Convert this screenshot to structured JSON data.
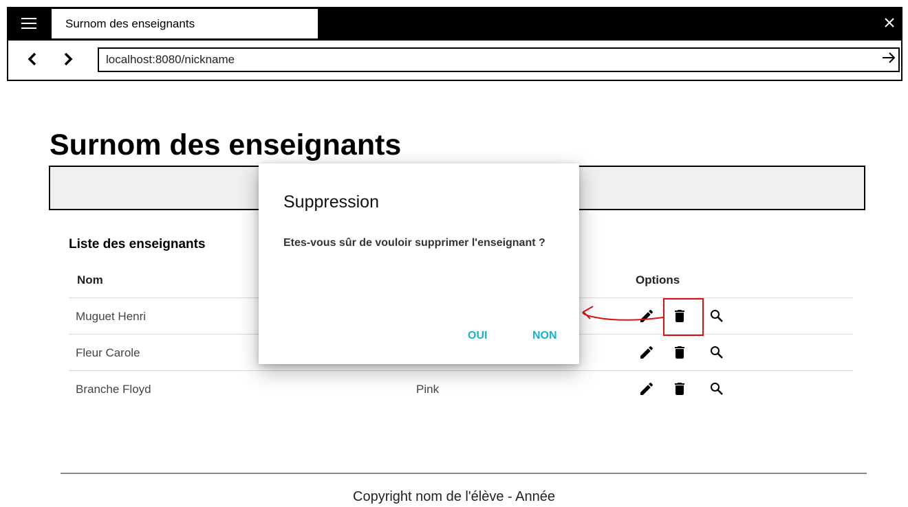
{
  "browser": {
    "tab_title": "Surnom des enseignants",
    "url": "localhost:8080/nickname",
    "icons": {
      "menu": "menu-icon",
      "close": "close-icon",
      "back": "chevron-left-icon",
      "forward": "chevron-right-icon",
      "go": "arrow-right-icon"
    }
  },
  "page": {
    "title": "Surnom des enseignants",
    "list_title": "Liste des enseignants",
    "columns": {
      "name": "Nom",
      "options": "Options"
    },
    "rows": [
      {
        "name": "Muguet Henri",
        "nickname": ""
      },
      {
        "name": "Fleur Carole",
        "nickname": ""
      },
      {
        "name": "Branche Floyd",
        "nickname": "Pink"
      }
    ],
    "action_icons": [
      "pencil-icon",
      "trash-icon",
      "magnifier-icon"
    ],
    "footer": "Copyright nom de l'élève - Année"
  },
  "dialog": {
    "title": "Suppression",
    "message": "Etes-vous sûr de vouloir supprimer l'enseignant ?",
    "confirm_label": "OUI",
    "cancel_label": "NON"
  },
  "colors": {
    "dialog_button": "#17b0cf",
    "highlight": "#e01010",
    "annotation_arrow": "#e01010"
  }
}
